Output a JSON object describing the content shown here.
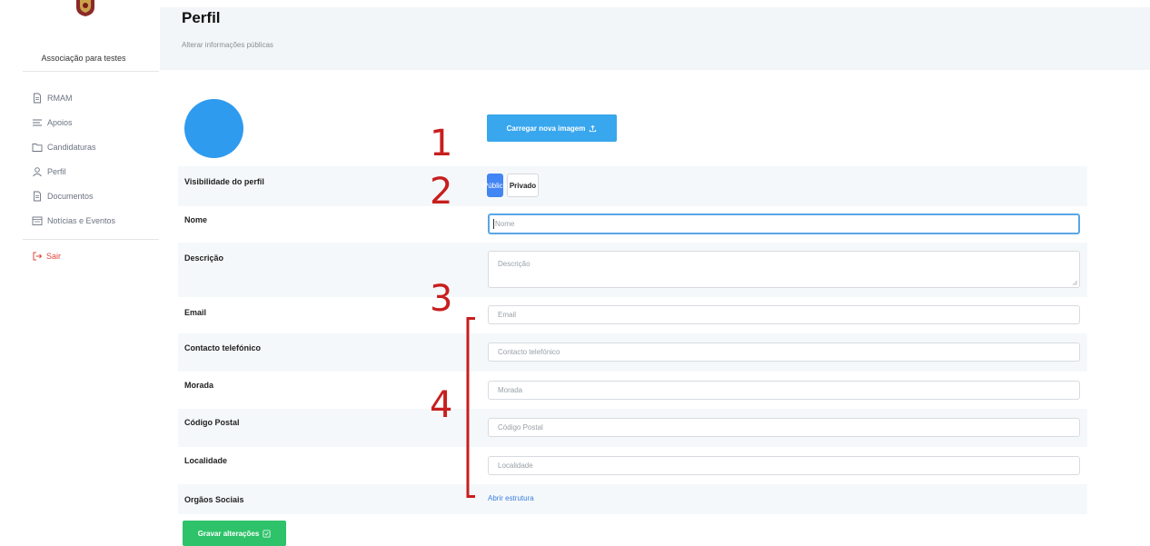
{
  "sidebar": {
    "org_name": "Associação para testes",
    "items": [
      {
        "label": "RMAM",
        "icon": "document-icon"
      },
      {
        "label": "Apoios",
        "icon": "list-icon"
      },
      {
        "label": "Candidaturas",
        "icon": "folder-icon"
      },
      {
        "label": "Perfil",
        "icon": "user-icon"
      },
      {
        "label": "Documentos",
        "icon": "document-icon"
      },
      {
        "label": "Notícias e Eventos",
        "icon": "news-icon"
      }
    ],
    "logout_label": "Sair"
  },
  "header": {
    "title": "Perfil",
    "subtitle": "Alterar informações públicas"
  },
  "profile": {
    "upload_label": "Carregar nova imagem",
    "visibility": {
      "label": "Visibilidade do perfil",
      "options": [
        "Público",
        "Privado"
      ],
      "selected": "Público"
    },
    "fields": {
      "name": {
        "label": "Nome",
        "placeholder": "Nome"
      },
      "description": {
        "label": "Descrição",
        "placeholder": "Descrição"
      },
      "email": {
        "label": "Email",
        "placeholder": "Email"
      },
      "phone": {
        "label": "Contacto telefónico",
        "placeholder": "Contacto telefónico"
      },
      "address": {
        "label": "Morada",
        "placeholder": "Morada"
      },
      "postal_code": {
        "label": "Código Postal",
        "placeholder": "Código Postal"
      },
      "locality": {
        "label": "Localidade",
        "placeholder": "Localidade"
      }
    },
    "social_bodies": {
      "label": "Orgãos Sociais",
      "link": "Abrir estrutura"
    },
    "save_label": "Gravar alterações"
  },
  "annotations": [
    "1",
    "2",
    "3",
    "4"
  ],
  "colors": {
    "primary": "#38a7ee",
    "toggle_active": "#4285f4",
    "save": "#2ec26a",
    "logout": "#e0453a",
    "annotation": "#c81e1e",
    "avatar": "#2f9bef"
  }
}
